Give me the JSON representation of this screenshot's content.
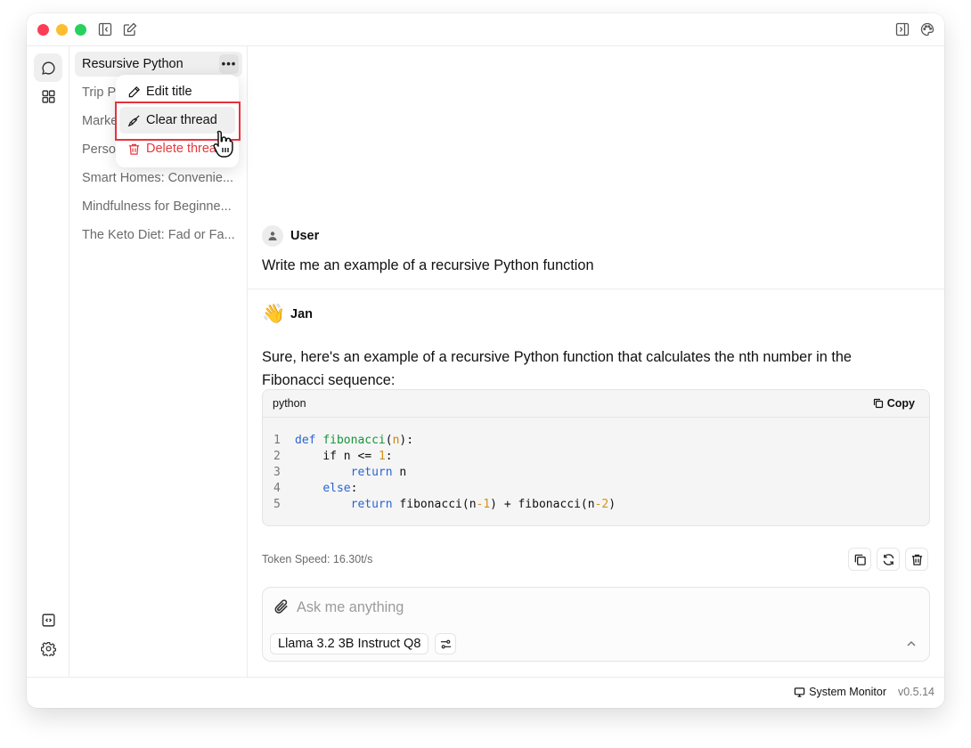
{
  "window": {
    "traffic_lights": {
      "close": "#fb3e55",
      "minimize": "#fdbd2e",
      "maximize": "#27d15f"
    },
    "titlebar_icons": {
      "left": [
        "collapse-sidebar-icon",
        "new-thread-icon"
      ],
      "right": [
        "toggle-right-panel-icon",
        "palette-icon"
      ]
    }
  },
  "rail": {
    "items": [
      {
        "icon": "chat-bubble-icon",
        "active": true
      },
      {
        "icon": "grid-icon",
        "active": false
      }
    ],
    "bottom": [
      {
        "icon": "code-box-icon"
      },
      {
        "icon": "gear-icon"
      }
    ]
  },
  "threads": {
    "items": [
      {
        "label": "Resursive Python",
        "active": true
      },
      {
        "label": "Trip P"
      },
      {
        "label": "Marke"
      },
      {
        "label": "Perso"
      },
      {
        "label": "Smart Homes: Convenie..."
      },
      {
        "label": "Mindfulness for Beginne..."
      },
      {
        "label": "The Keto Diet: Fad or Fa..."
      }
    ],
    "more_label": "•••"
  },
  "context_menu": {
    "items": [
      {
        "label": "Edit title",
        "icon": "pencil-icon"
      },
      {
        "label": "Clear thread",
        "icon": "broom-icon",
        "hovered": true
      },
      {
        "label": "Delete thread",
        "icon": "trash-icon",
        "danger": true
      }
    ],
    "danger_color": "#e5393f",
    "highlight_color": "#e8323c"
  },
  "conversation": {
    "user": {
      "name": "User",
      "text": "Write me an example of a recursive Python function"
    },
    "assistant": {
      "emoji": "👋",
      "name": "Jan",
      "text": "Sure, here's an example of a recursive Python function that calculates the nth number in the Fibonacci sequence:",
      "code": {
        "language": "python",
        "copy_label": "Copy",
        "lines": [
          {
            "n": "1",
            "indent": ""
          },
          {
            "n": "2",
            "indent": "    "
          },
          {
            "n": "3",
            "indent": "        "
          },
          {
            "n": "4",
            "indent": "    "
          },
          {
            "n": "5",
            "indent": "        "
          }
        ],
        "tokens": {
          "l1": [
            "def",
            "fibonacci",
            "(",
            "n",
            "):"
          ],
          "l2": [
            "if n <= ",
            "1",
            ":"
          ],
          "l3": [
            "return",
            " n"
          ],
          "l4": [
            "else",
            ":"
          ],
          "l5": [
            "return",
            " fibonacci(",
            "n",
            "-",
            "1",
            ") + fibonacci(",
            "n",
            "-",
            "2",
            ")"
          ]
        }
      },
      "token_speed": "Token Speed: 16.30t/s",
      "actions": [
        "copy-icon",
        "regenerate-icon",
        "delete-icon"
      ]
    }
  },
  "composer": {
    "placeholder": "Ask me anything",
    "value": "",
    "model": "Llama 3.2 3B Instruct Q8"
  },
  "statusbar": {
    "system_monitor": "System Monitor",
    "version": "v0.5.14"
  }
}
